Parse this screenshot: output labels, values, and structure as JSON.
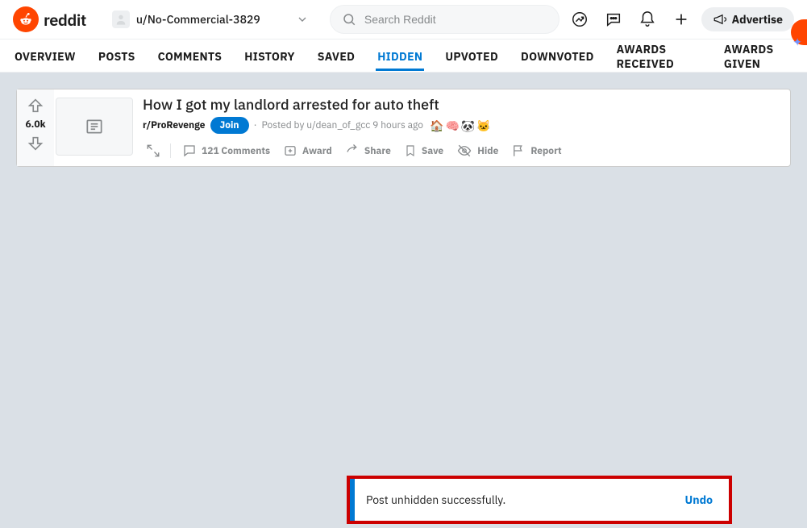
{
  "header": {
    "logo_text": "reddit",
    "profile_nav": "u/No-Commercial-3829",
    "search_placeholder": "Search Reddit",
    "advertise_label": "Advertise"
  },
  "tabs": [
    {
      "label": "OVERVIEW",
      "active": false
    },
    {
      "label": "POSTS",
      "active": false
    },
    {
      "label": "COMMENTS",
      "active": false
    },
    {
      "label": "HISTORY",
      "active": false
    },
    {
      "label": "SAVED",
      "active": false
    },
    {
      "label": "HIDDEN",
      "active": true
    },
    {
      "label": "UPVOTED",
      "active": false
    },
    {
      "label": "DOWNVOTED",
      "active": false
    },
    {
      "label": "AWARDS RECEIVED",
      "active": false
    },
    {
      "label": "AWARDS GIVEN",
      "active": false
    }
  ],
  "post": {
    "score": "6.0k",
    "title": "How I got my landlord arrested for auto theft",
    "subreddit": "r/ProRevenge",
    "join_label": "Join",
    "posted_by_prefix": "Posted by ",
    "author": "u/dean_of_gcc",
    "time": "9 hours ago",
    "awards": [
      "🏠",
      "🧠",
      "🐼",
      "🐱"
    ],
    "actions": {
      "comments": "121 Comments",
      "award": "Award",
      "share": "Share",
      "save": "Save",
      "hide": "Hide",
      "report": "Report"
    }
  },
  "toast": {
    "message": "Post unhidden successfully.",
    "action": "Undo"
  }
}
